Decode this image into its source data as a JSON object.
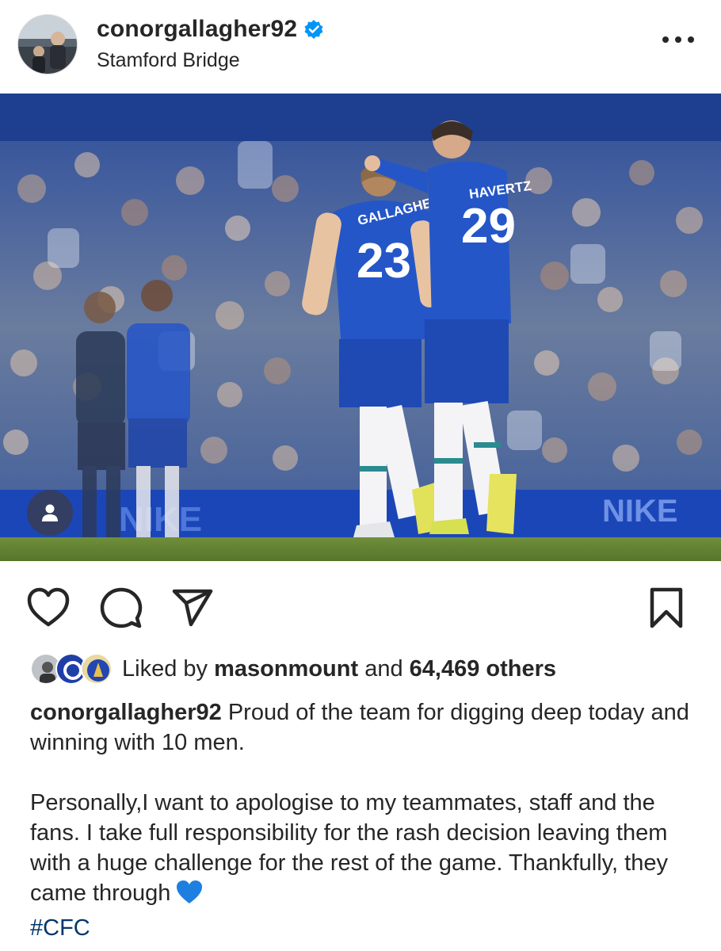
{
  "post": {
    "username": "conorgallagher92",
    "verified": true,
    "location": "Stamford Bridge",
    "more_icon": "more-horizontal-icon"
  },
  "photo": {
    "player_left_name": "GALLAGHER",
    "player_left_number": "23",
    "player_right_name": "HAVERTZ",
    "player_right_number": "29",
    "ad_board_text": "NIKE",
    "tag_icon": "user-tag-icon"
  },
  "actions": {
    "like_icon": "heart-icon",
    "comment_icon": "comment-icon",
    "share_icon": "send-icon",
    "save_icon": "bookmark-icon"
  },
  "likes": {
    "prefix": "Liked by",
    "liked_by_user": "masonmount",
    "conjunction": "and",
    "others_count": "64,469 others"
  },
  "caption": {
    "username": "conorgallagher92",
    "line1": "Proud of the team for digging deep today and winning with 10 men.",
    "paragraph2": "Personally,I want to apologise to my teammates, staff and the fans. I take full responsibility for the rash decision leaving them with a huge challenge for the rest of the game. Thankfully, they came through",
    "emoji_name": "blue-heart",
    "hashtag": "#CFC"
  },
  "colors": {
    "text": "#262626",
    "hashtag": "#00376b",
    "verified_blue": "#0095f6",
    "chelsea_blue": "#1f4fc6"
  }
}
